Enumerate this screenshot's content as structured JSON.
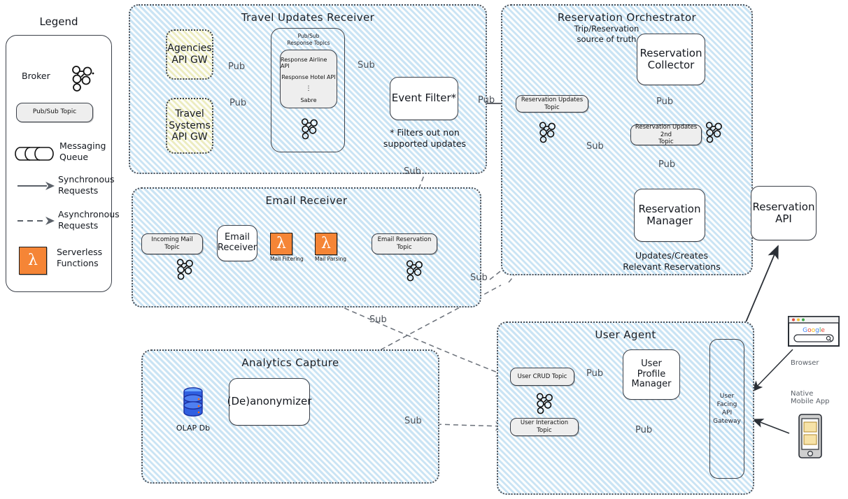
{
  "legend": {
    "title": "Legend",
    "items": [
      {
        "label": "Broker",
        "icon": "broker-icon"
      },
      {
        "label": "Pub/Sub Topic",
        "icon": "topic-pill-icon"
      },
      {
        "label": "Messaging Queue",
        "icon": "queue-icon"
      },
      {
        "label": "Synchronous Requests",
        "icon": "solid-arrow-icon"
      },
      {
        "label": "Asynchronous Requests",
        "icon": "dashed-arrow-icon"
      },
      {
        "label": "Serverless Functions",
        "icon": "lambda-icon"
      }
    ]
  },
  "sections": {
    "travel_updates_receiver": {
      "title": "Travel Updates Receiver",
      "gateways": [
        "Agencies\nAPI GW",
        "Travel\nSystems\nAPI GW"
      ],
      "gateway_agencies": "Agencies API GW",
      "gateway_travel": "Travel Systems API GW",
      "pubsub_title": "Pub/Sub\nResponse Topics",
      "pubsub_title_line1": "Pub/Sub",
      "pubsub_title_line2": "Response Topics",
      "response_topics": [
        "Response Airline API",
        "Response Hotel API",
        "⋮",
        "Sabre"
      ],
      "event_filter": "Event Filter*",
      "event_filter_note": "* Filters out non\nsupported updates",
      "event_filter_note_l1": "* Filters out non",
      "event_filter_note_l2": "supported updates"
    },
    "email_receiver": {
      "title": "Email Receiver",
      "incoming_mail_topic": "Incoming Mail\nTopic",
      "incoming_mail_topic_l1": "Incoming Mail",
      "incoming_mail_topic_l2": "Topic",
      "email_receiver_service": "Email\nReceiver",
      "email_receiver_l1": "Email",
      "email_receiver_l2": "Receiver",
      "lambda1": "Mail Filtering",
      "lambda2": "Mail Parsing",
      "email_reservation_topic_l1": "Email Reservation",
      "email_reservation_topic_l2": "Topic"
    },
    "analytics_capture": {
      "title": "Analytics Capture",
      "olap_db": "OLAP Db",
      "deanonymizer": "(De)anonymizer"
    },
    "reservation_orchestrator": {
      "title": "Reservation Orchestrator",
      "source_of_truth_note_l1": "Trip/Reservation",
      "source_of_truth_note_l2": "source of truth",
      "reservation_collector_l1": "Reservation",
      "reservation_collector_l2": "Collector",
      "reservation_updates_topic": "Reservation Updates Topic",
      "reservation_updates_2nd_topic_l1": "Reservation Updates 2nd",
      "reservation_updates_2nd_topic_l2": "Topic",
      "reservation_manager_l1": "Reservation",
      "reservation_manager_l2": "Manager",
      "reservation_api_l1": "Reservation",
      "reservation_api_l2": "API",
      "bottom_note_l1": "Updates/Creates",
      "bottom_note_l2": "Relevant Reservations"
    },
    "user_agent": {
      "title": "User Agent",
      "user_crud_topic": "User CRUD Topic",
      "user_interaction_topic": "User Interaction Topic",
      "user_profile_manager_l1": "User",
      "user_profile_manager_l2": "Profile",
      "user_profile_manager_l3": "Manager",
      "user_facing_api_gateway_l1": "User Facing",
      "user_facing_api_gateway_l2": "API",
      "user_facing_api_gateway_l3": "Gateway"
    }
  },
  "clients": {
    "browser_label": "Browser",
    "browser_brand": "Google",
    "mobile_label_l1": "Native",
    "mobile_label_l2": "Mobile App"
  },
  "edge_labels": {
    "pub_agencies": "Pub",
    "pub_travel": "Pub",
    "sub_event_filter": "Sub",
    "sub_to_email": "Sub",
    "pub_to_res_updates": "Pub",
    "pub_collector": "Pub",
    "pub_manager": "Pub",
    "sub_orchestrator": "Sub",
    "sub_email_reservation": "Sub",
    "sub_crud": "Sub",
    "sub_analytics": "Sub",
    "pub_profile_manager": "Pub",
    "pub_gateway_interaction": "Pub"
  },
  "colors": {
    "section_fill": "#e8f4fb",
    "section_border": "#4a4f57",
    "gateway_fill": "#f7f7e0",
    "topic_fill": "#eeeeee",
    "lambda_orange": "#f58536",
    "db_blue": "#2b50d8",
    "line": "#6b717a"
  }
}
